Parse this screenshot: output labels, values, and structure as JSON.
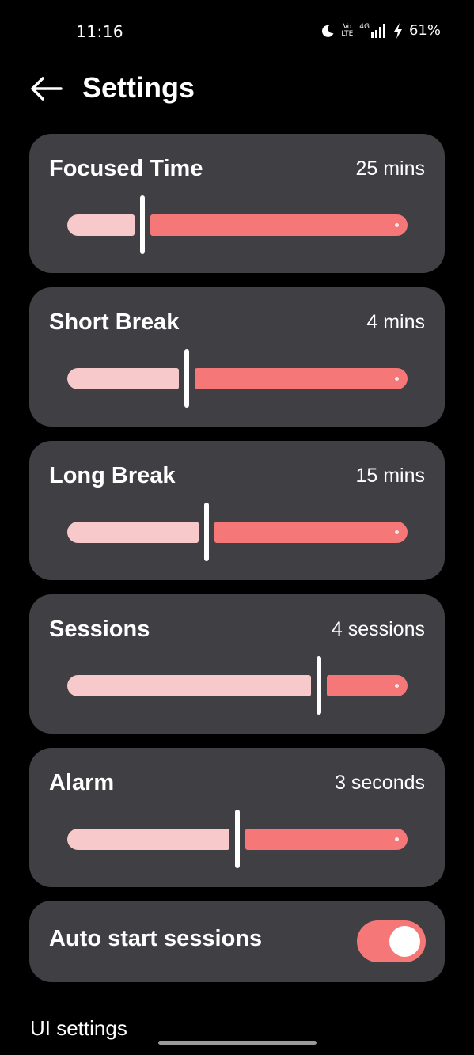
{
  "status_bar": {
    "time": "11:16",
    "battery": "61%",
    "icons": [
      "moon-icon",
      "volte-icon",
      "signal-4g-icon",
      "charging-icon"
    ],
    "volte_top": "Vo",
    "volte_bottom": "LTE",
    "network": "4G"
  },
  "header": {
    "back_icon": "arrow-left-icon",
    "title": "Settings"
  },
  "settings": [
    {
      "id": "focused-time",
      "label": "Focused Time",
      "value": "25 mins",
      "slider_fraction": 0.22
    },
    {
      "id": "short-break",
      "label": "Short Break",
      "value": "4 mins",
      "slider_fraction": 0.35
    },
    {
      "id": "long-break",
      "label": "Long Break",
      "value": "15 mins",
      "slider_fraction": 0.41
    },
    {
      "id": "sessions",
      "label": "Sessions",
      "value": "4 sessions",
      "slider_fraction": 0.74
    },
    {
      "id": "alarm",
      "label": "Alarm",
      "value": "3 seconds",
      "slider_fraction": 0.5
    }
  ],
  "auto_start": {
    "label": "Auto start sessions",
    "enabled": true
  },
  "section": {
    "ui_settings_label": "UI settings"
  },
  "colors": {
    "background": "#000000",
    "card": "#3f3f44",
    "accent": "#f57778",
    "accent_light": "#f8c9cb"
  }
}
